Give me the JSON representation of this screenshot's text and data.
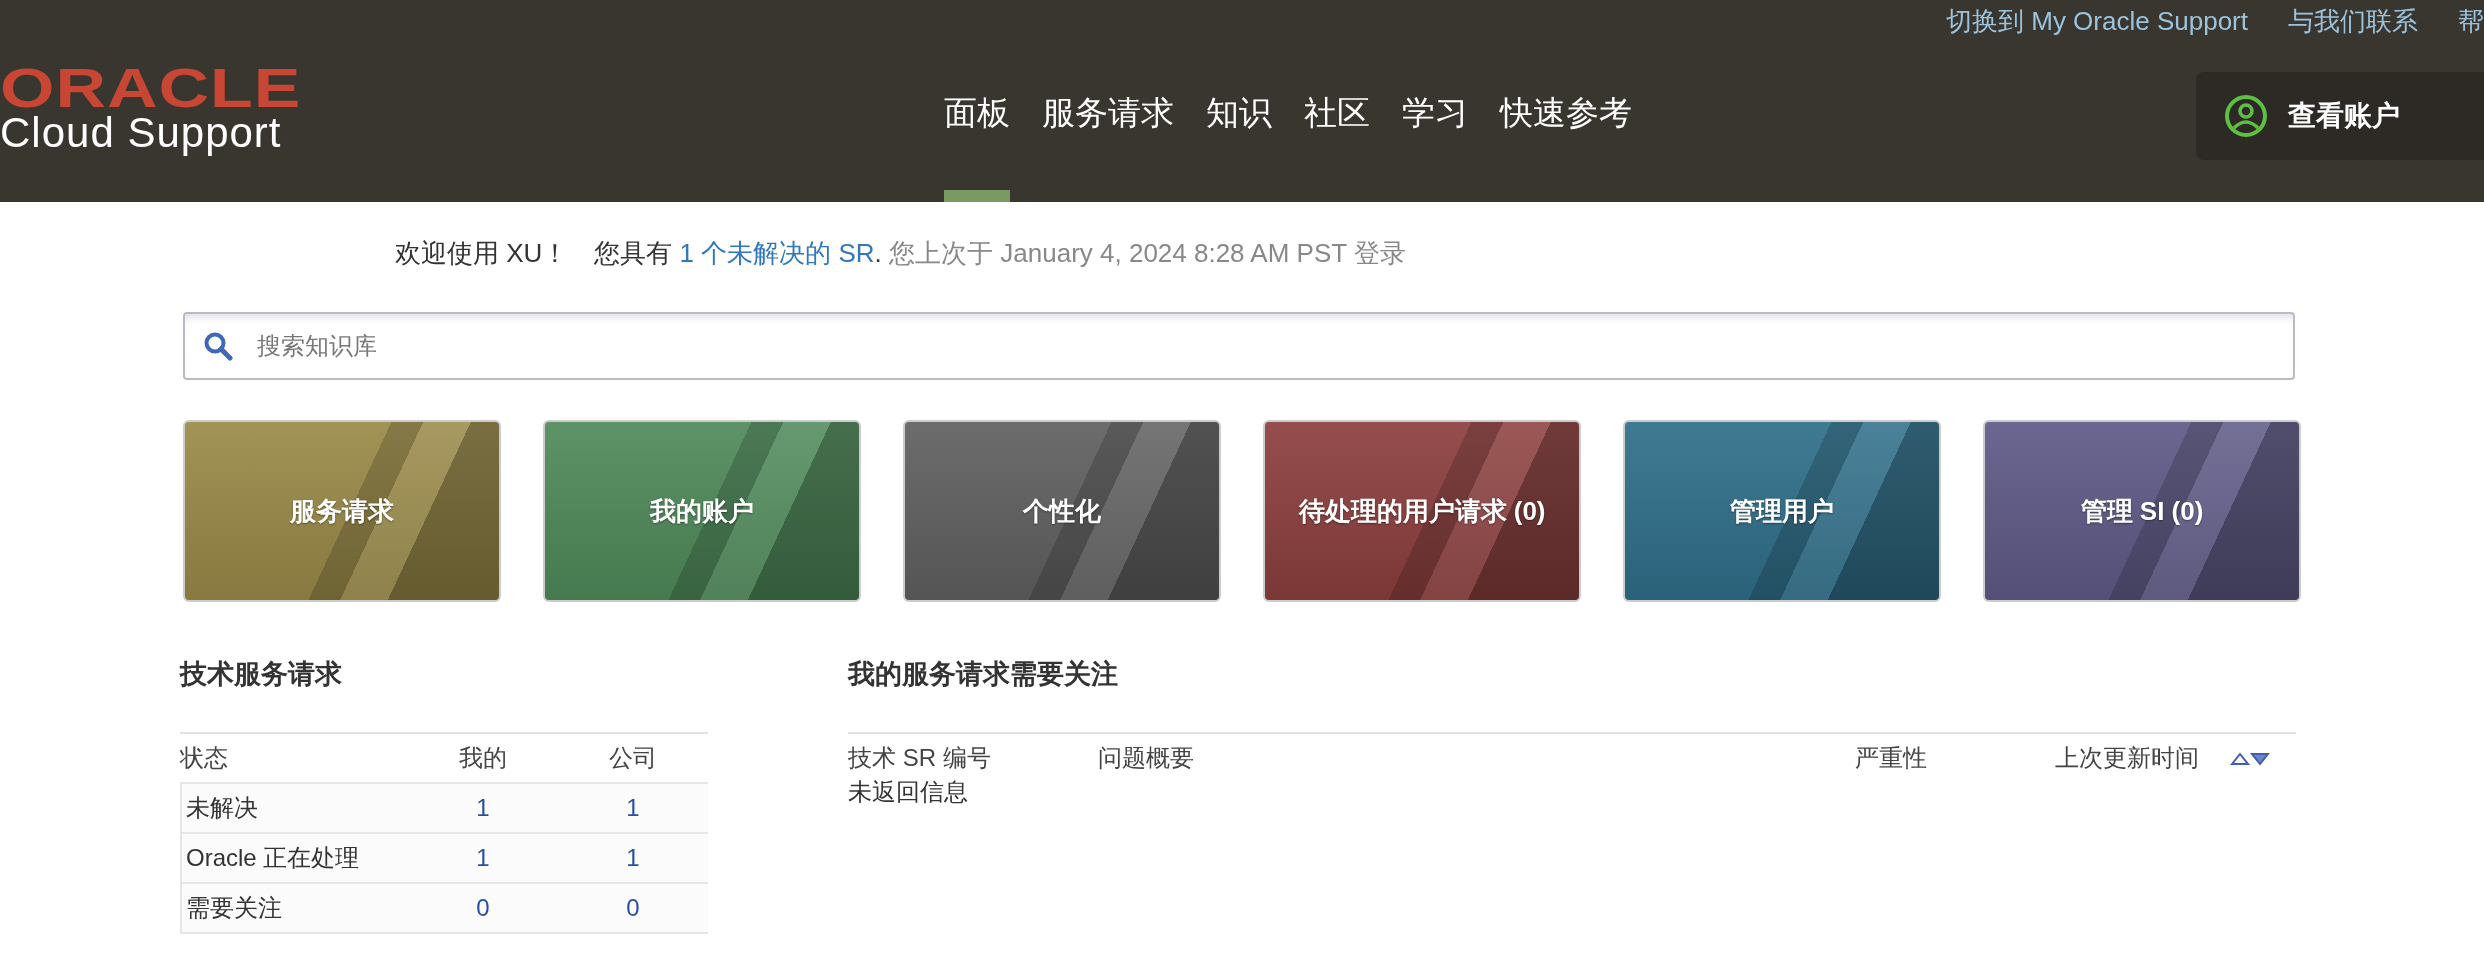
{
  "header": {
    "logo": {
      "brand": "ORACLE",
      "product": "Cloud Support"
    },
    "top_links": [
      "切换到 My Oracle Support",
      "与我们联系",
      "帮"
    ],
    "nav": [
      {
        "label": "面板",
        "selected": true
      },
      {
        "label": "服务请求",
        "selected": false
      },
      {
        "label": "知识",
        "selected": false
      },
      {
        "label": "社区",
        "selected": false
      },
      {
        "label": "学习",
        "selected": false
      },
      {
        "label": "快速参考",
        "selected": false
      }
    ],
    "account_button": "查看账户"
  },
  "welcome": {
    "greeting": "欢迎使用 XU！",
    "prefix": "您具有",
    "link": "1 个未解决的 SR",
    "period": ".",
    "last_login": "您上次于 January 4, 2024 8:28 AM PST 登录"
  },
  "search": {
    "placeholder": "搜索知识库"
  },
  "tiles": [
    {
      "label": "服务请求",
      "color": "#9a8a48"
    },
    {
      "label": "我的账户",
      "color": "#4f8a5a"
    },
    {
      "label": "个性化",
      "color": "#606060"
    },
    {
      "label": "待处理的用户请求 (0)",
      "color": "#8c3f3e"
    },
    {
      "label": "管理用户",
      "color": "#2f6f8a"
    },
    {
      "label": "管理 SI (0)",
      "color": "#5f5a87"
    }
  ],
  "tech_requests": {
    "title": "技术服务请求",
    "columns": [
      "状态",
      "我的",
      "公司"
    ],
    "rows": [
      {
        "status": "未解决",
        "mine": "1",
        "company": "1"
      },
      {
        "status": "Oracle 正在处理",
        "mine": "1",
        "company": "1"
      },
      {
        "status": "需要关注",
        "mine": "0",
        "company": "0"
      }
    ]
  },
  "attention": {
    "title": "我的服务请求需要关注",
    "columns": [
      "技术 SR 编号",
      "问题概要",
      "严重性",
      "上次更新时间"
    ],
    "empty_message": "未返回信息"
  }
}
